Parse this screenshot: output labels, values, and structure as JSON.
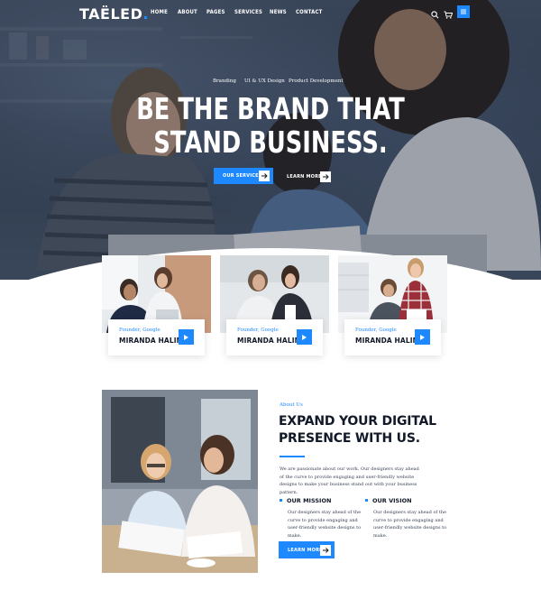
{
  "brand": {
    "logo_text": "TAËLED",
    "logo_dot": ".",
    "accent_color": "#1e88ff"
  },
  "nav": {
    "items": [
      {
        "label": "HOME"
      },
      {
        "label": "ABOUT"
      },
      {
        "label": "PAGES"
      },
      {
        "label": "SERVICES"
      },
      {
        "label": "NEWS"
      },
      {
        "label": "CONTACT"
      }
    ],
    "icons": [
      "search-icon",
      "cart-icon",
      "menu-icon"
    ]
  },
  "hero": {
    "tags": [
      "Branding",
      "UI & UX Design",
      "Product Development"
    ],
    "title_line1": "BE THE BRAND THAT",
    "title_line2": "STAND BUSINESS.",
    "primary_button": "OUR SERVICES",
    "secondary_button": "LEARN MORE"
  },
  "team": [
    {
      "role": "Founder, Google",
      "name": "MIRANDA HALIM"
    },
    {
      "role": "Founder, Google",
      "name": "MIRANDA HALIM"
    },
    {
      "role": "Founder, Google",
      "name": "MIRANDA HALIM"
    }
  ],
  "about": {
    "eyebrow": "About Us",
    "title_line1": "EXPAND YOUR DIGITAL",
    "title_line2": "PRESENCE WITH US.",
    "body": "We are passionate about our work. Our designers stay ahead of the curve to provide engaging and user-friendly website designs to make your business stand out with your business pattern.",
    "mission": {
      "heading": "OUR MISSION",
      "text": "Our designers stay ahead of the curve to provide engaging and user-friendly website designs to make."
    },
    "vision": {
      "heading": "OUR VISION",
      "text": "Our designers stay ahead of the curve to provide engaging and user-friendly website designs to make."
    },
    "button": "LEARN MORE"
  }
}
